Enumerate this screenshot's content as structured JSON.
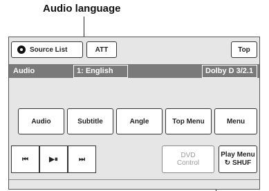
{
  "callout": {
    "label": "Audio language"
  },
  "top_bar": {
    "source_list": "Source List",
    "att": "ATT",
    "top": "Top"
  },
  "info_bar": {
    "audio": "Audio",
    "language": "1: English",
    "format": "Dolby D 3/2.1"
  },
  "menu_buttons": [
    "Audio",
    "Subtitle",
    "Angle",
    "Top Menu",
    "Menu"
  ],
  "transport": {
    "prev": "⏮",
    "play_pause": "▶⏸",
    "next": "⏭"
  },
  "dvd_control": {
    "line1": "DVD",
    "line2": "Control"
  },
  "play_menu": {
    "line1": "Play Menu",
    "line2": "↻ SHUF"
  }
}
